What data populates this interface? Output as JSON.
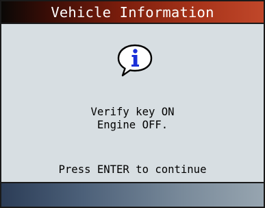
{
  "screen": {
    "title": "Vehicle Information",
    "icon": "info-icon",
    "message_lines": [
      "Verify key ON",
      "Engine OFF."
    ],
    "prompt": "Press ENTER to continue"
  },
  "colors": {
    "title_bar_dark": "#0a0806",
    "title_bar_red": "#c0472a",
    "screen_background": "#d7dee2",
    "info_icon_letter": "#1a2fd8",
    "function_bar_dark": "#2c3d57",
    "function_bar_light": "#97a5b0"
  }
}
